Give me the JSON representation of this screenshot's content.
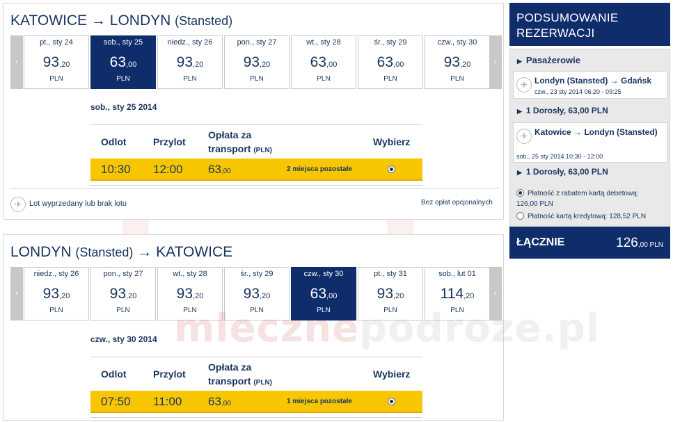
{
  "outbound": {
    "origin": "KATOWICE",
    "arrow": "→",
    "destination": "LONDYN",
    "destination_sub": "(Stansted)",
    "prev_arrow": "‹",
    "next_arrow": "›",
    "days": [
      {
        "label": "pt., sty 24",
        "int": "93",
        "dec": ",20",
        "currency": "PLN",
        "selected": false
      },
      {
        "label": "sob., sty 25",
        "int": "63",
        "dec": ",00",
        "currency": "PLN",
        "selected": true
      },
      {
        "label": "niedz., sty 26",
        "int": "93",
        "dec": ",20",
        "currency": "PLN",
        "selected": false
      },
      {
        "label": "pon., sty 27",
        "int": "93",
        "dec": ",20",
        "currency": "PLN",
        "selected": false
      },
      {
        "label": "wt., sty 28",
        "int": "63",
        "dec": ",00",
        "currency": "PLN",
        "selected": false
      },
      {
        "label": "śr., sty 29",
        "int": "63",
        "dec": ",00",
        "currency": "PLN",
        "selected": false
      },
      {
        "label": "czw., sty 30",
        "int": "93",
        "dec": ",20",
        "currency": "PLN",
        "selected": false
      }
    ],
    "selected_date": "sob., sty 25 2014",
    "headers": {
      "depart": "Odlot",
      "arrive": "Przylot",
      "fare_l1": "Opłata za",
      "fare_l2": "transport",
      "fare_cur": "(PLN)",
      "select": "Wybierz"
    },
    "flight": {
      "depart": "10:30",
      "arrive": "12:00",
      "price_int": "63",
      "price_dec": ",00",
      "seats": "2 miejsca pozostałe",
      "checked": true
    }
  },
  "legend": {
    "soldout": "Lot wyprzedany lub brak lotu",
    "no_fees": "Bez opłat opcjonalnych"
  },
  "inbound": {
    "origin": "LONDYN",
    "origin_sub": "(Stansted)",
    "arrow": "→",
    "destination": "KATOWICE",
    "prev_arrow": "‹",
    "next_arrow": "›",
    "days": [
      {
        "label": "niedz., sty 26",
        "int": "93",
        "dec": ",20",
        "currency": "PLN",
        "selected": false
      },
      {
        "label": "pon., sty 27",
        "int": "93",
        "dec": ",20",
        "currency": "PLN",
        "selected": false
      },
      {
        "label": "wt., sty 28",
        "int": "93",
        "dec": ",20",
        "currency": "PLN",
        "selected": false
      },
      {
        "label": "śr., sty 29",
        "int": "93",
        "dec": ",20",
        "currency": "PLN",
        "selected": false
      },
      {
        "label": "czw., sty 30",
        "int": "63",
        "dec": ",00",
        "currency": "PLN",
        "selected": true
      },
      {
        "label": "pt., sty 31",
        "int": "93",
        "dec": ",20",
        "currency": "PLN",
        "selected": false
      },
      {
        "label": "sob., lut 01",
        "int": "114",
        "dec": ",20",
        "currency": "PLN",
        "selected": false
      }
    ],
    "selected_date": "czw., sty 30 2014",
    "headers": {
      "depart": "Odlot",
      "arrive": "Przylot",
      "fare_l1": "Opłata za",
      "fare_l2": "transport",
      "fare_cur": "(PLN)",
      "select": "Wybierz"
    },
    "flight": {
      "depart": "07:50",
      "arrive": "11:00",
      "price_int": "63",
      "price_dec": ",00",
      "seats": "1 miejsca pozostałe",
      "checked": true
    }
  },
  "summary": {
    "title_l1": "PODSUMOWANIE",
    "title_l2": "REZERWACJI",
    "passengers": "Pasażerowie",
    "flights": [
      {
        "route": "Londyn (Stansted) → Gdańsk",
        "time": "czw., 23 sty 2014 06:20 - 09:25",
        "pax": "1 Dorosły, 63,00 PLN"
      },
      {
        "route": "Katowice → Londyn (Stansted)",
        "time": "sob., 25 sty 2014 10:30 - 12:00",
        "pax": "1 Dorosły, 63,00 PLN"
      }
    ],
    "payment_debit_l1": "Płatność z rabatem kartą debetową:",
    "payment_debit_l2": "126,00 PLN",
    "payment_credit": "Płatność kartą kredytową: 128,52 PLN",
    "total_label": "ŁĄCZNIE",
    "total_int": "126",
    "total_dec": ",00 PLN"
  },
  "watermark": {
    "part1": "mleczne",
    "part2": "podroze",
    "part3": ".pl"
  },
  "icons": {
    "plane": "✈",
    "triangle": "▶"
  },
  "colors": {
    "navy": "#0f2d6b",
    "yellow": "#f7c600",
    "text": "#17345f"
  }
}
